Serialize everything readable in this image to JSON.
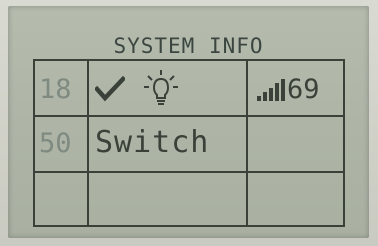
{
  "screen": {
    "title": "SYSTEM INFO"
  },
  "rows": [
    {
      "number": "18",
      "status_icon": "checkmark-icon",
      "device_icon": "lightbulb-icon",
      "signal_icon": "signal-bars-icon",
      "signal_value": "69"
    },
    {
      "number": "50",
      "label": "Switch"
    },
    {
      "number": "",
      "label": ""
    }
  ],
  "colors": {
    "lcd_background": "#aeb5a7",
    "lcd_foreground": "#3a4139",
    "dim_text": "#7f8a80"
  }
}
